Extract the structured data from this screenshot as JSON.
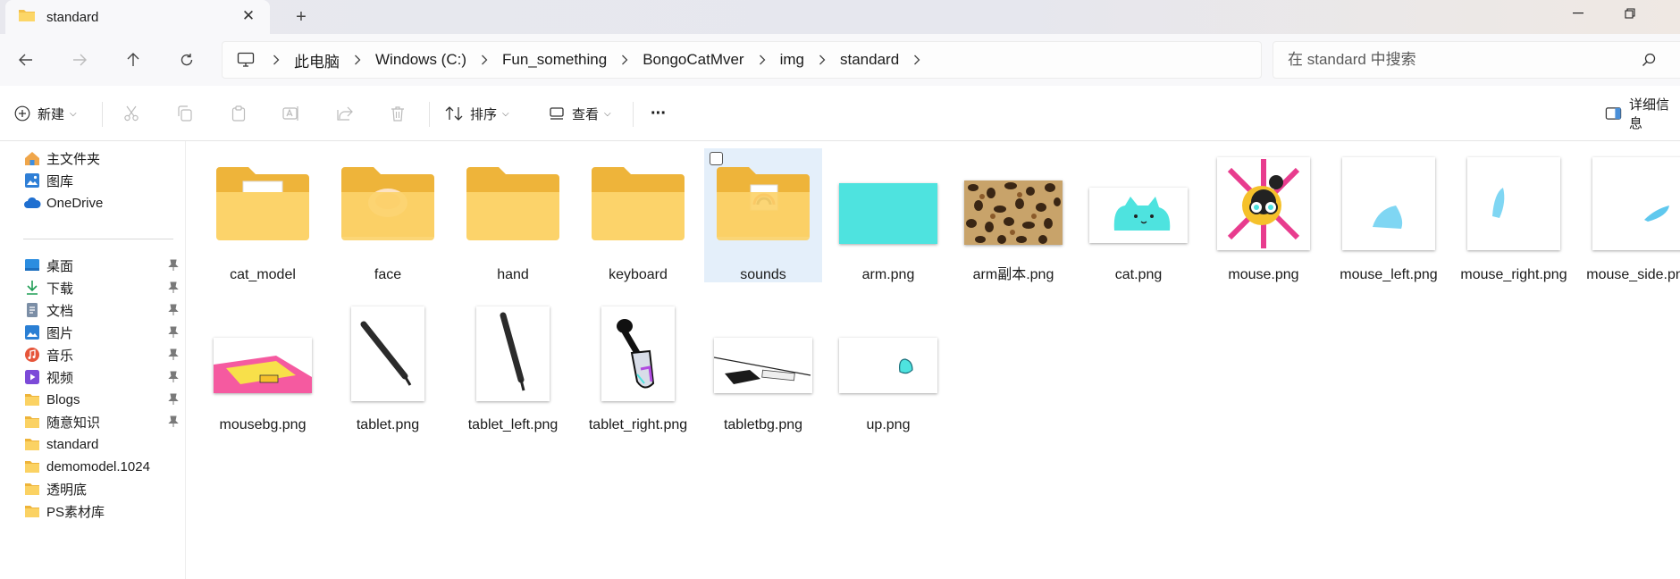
{
  "window": {
    "tab_title": "standard",
    "new_tab": "+"
  },
  "nav": {
    "breadcrumbs": [
      "此电脑",
      "Windows (C:)",
      "Fun_something",
      "BongoCatMver",
      "img",
      "standard"
    ],
    "search_placeholder": "在 standard 中搜索"
  },
  "commands": {
    "new": "新建",
    "sort": "排序",
    "view": "查看",
    "more": "···",
    "details": "详细信息"
  },
  "sidebar": {
    "top": [
      {
        "label": "主文件夹",
        "icon": "home-icon"
      },
      {
        "label": "图库",
        "icon": "gallery-icon"
      },
      {
        "label": "OneDrive",
        "icon": "cloud-icon"
      }
    ],
    "quick": [
      {
        "label": "桌面",
        "icon": "desktop-icon",
        "pinned": true
      },
      {
        "label": "下载",
        "icon": "download-icon",
        "pinned": true
      },
      {
        "label": "文档",
        "icon": "document-icon",
        "pinned": true
      },
      {
        "label": "图片",
        "icon": "pictures-icon",
        "pinned": true
      },
      {
        "label": "音乐",
        "icon": "music-icon",
        "pinned": true
      },
      {
        "label": "视频",
        "icon": "video-icon",
        "pinned": true
      },
      {
        "label": "Blogs",
        "icon": "folder-icon",
        "pinned": true
      },
      {
        "label": "随意知识",
        "icon": "folder-icon",
        "pinned": true
      },
      {
        "label": "standard",
        "icon": "folder-icon",
        "pinned": false
      },
      {
        "label": "demomodel.1024",
        "icon": "folder-icon",
        "pinned": false
      },
      {
        "label": "透明底",
        "icon": "folder-icon",
        "pinned": false
      },
      {
        "label": "PS素材库",
        "icon": "folder-icon",
        "pinned": false
      }
    ]
  },
  "files": [
    {
      "name": "cat_model",
      "kind": "folder"
    },
    {
      "name": "face",
      "kind": "folder"
    },
    {
      "name": "hand",
      "kind": "folder"
    },
    {
      "name": "keyboard",
      "kind": "folder"
    },
    {
      "name": "sounds",
      "kind": "folder",
      "selected": true
    },
    {
      "name": "arm.png",
      "kind": "image"
    },
    {
      "name": "arm副本.png",
      "kind": "image"
    },
    {
      "name": "cat.png",
      "kind": "image"
    },
    {
      "name": "mouse.png",
      "kind": "image"
    },
    {
      "name": "mouse_left.png",
      "kind": "image"
    },
    {
      "name": "mouse_right.png",
      "kind": "image"
    },
    {
      "name": "mouse_side.png",
      "kind": "image"
    },
    {
      "name": "mousebg.png",
      "kind": "image"
    },
    {
      "name": "tablet.png",
      "kind": "image"
    },
    {
      "name": "tablet_left.png",
      "kind": "image"
    },
    {
      "name": "tablet_right.png",
      "kind": "image"
    },
    {
      "name": "tabletbg.png",
      "kind": "image"
    },
    {
      "name": "up.png",
      "kind": "image"
    }
  ]
}
